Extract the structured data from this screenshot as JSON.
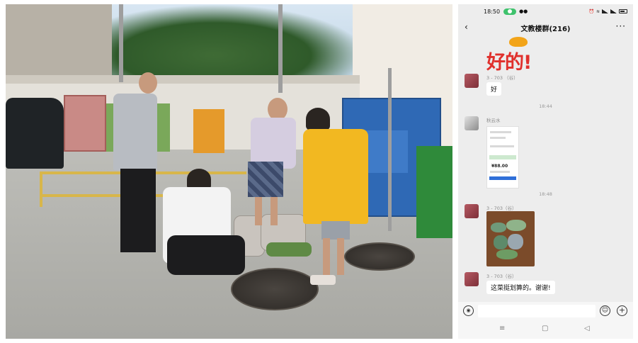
{
  "photo": {
    "description_icons": [
      "recycling-bin-icon",
      "manhole-cover-icon"
    ]
  },
  "phone": {
    "status": {
      "time": "18:50"
    },
    "header": {
      "title": "文教楼群(216)",
      "back_icon": "chevron-left-icon",
      "more_icon": "more-dots-icon"
    },
    "sticker": {
      "text": "好的!"
    },
    "messages": [
      {
        "sender": "3 - 703 （谷）",
        "text": "好"
      },
      {
        "timestamp": "18:44"
      },
      {
        "sender": "秋云水",
        "image": "payment-screenshot",
        "amount": "¥88.00"
      },
      {
        "timestamp": "18:48"
      },
      {
        "sender": "3 - 703（谷）",
        "image": "vegetables-photo"
      },
      {
        "sender": "3 - 703（谷）",
        "text": "这菜挺划算的。谢谢!"
      }
    ],
    "input": {
      "placeholder": ""
    },
    "nav": {
      "menu": "≡",
      "home": "▢",
      "back": "◁"
    },
    "colors": {
      "accent_green": "#3ec26c",
      "chat_bg": "#ededed",
      "sticker_red": "#e0302c"
    }
  }
}
